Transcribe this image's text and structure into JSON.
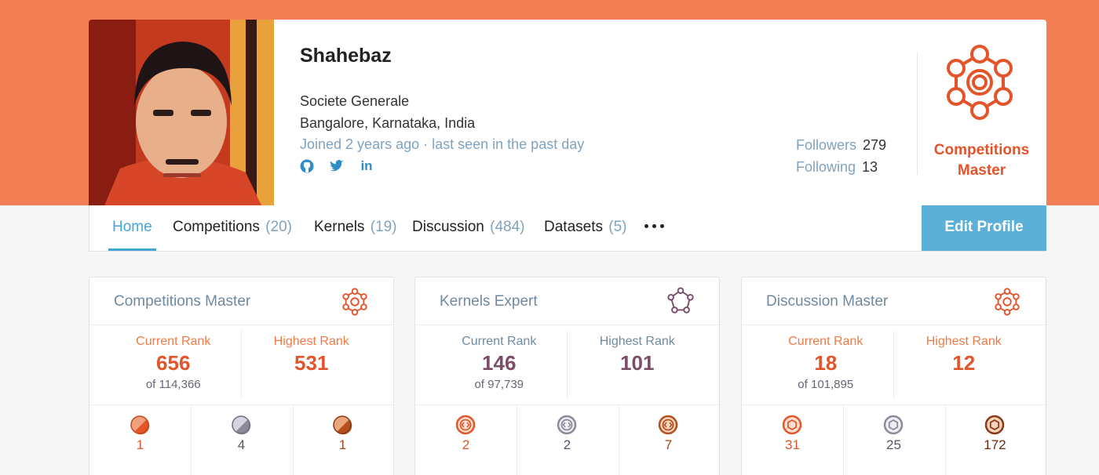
{
  "profile": {
    "name": "Shahebaz",
    "organization": "Societe Generale",
    "location": "Bangalore, Karnataka, India",
    "joined": "Joined 2 years ago · last seen in the past day",
    "socials": [
      {
        "icon": "github-icon"
      },
      {
        "icon": "twitter-icon"
      },
      {
        "icon": "linkedin-icon",
        "text": "in"
      }
    ],
    "followers_label": "Followers",
    "followers": "279",
    "following_label": "Following",
    "following": "13",
    "tier": "Competitions Master"
  },
  "colors": {
    "brand": "#f47f55",
    "master": "#e4542a",
    "expert": "#7b4d6a",
    "link": "#44a5d6",
    "muted": "#7fa3bf",
    "gold": "#e2562a",
    "silver": "#8a8a9a",
    "bronze": "#a5441c"
  },
  "nav": {
    "tabs": [
      {
        "label": "Home",
        "count": ""
      },
      {
        "label": "Competitions",
        "count": "(20)"
      },
      {
        "label": "Kernels",
        "count": "(19)"
      },
      {
        "label": "Discussion",
        "count": "(484)"
      },
      {
        "label": "Datasets",
        "count": "(5)"
      }
    ],
    "active": "Home",
    "more_icon": "more-dots-icon",
    "edit_button": "Edit Profile"
  },
  "cards": [
    {
      "title": "Competitions Master",
      "icon": "competitions-master-icon",
      "current_rank_label": "Current Rank",
      "current_rank": "656",
      "current_of": "of 114,366",
      "highest_rank_label": "Highest Rank",
      "highest_rank": "531",
      "medals": [
        {
          "type": "gold",
          "count": "1"
        },
        {
          "type": "silver",
          "count": "4"
        },
        {
          "type": "bronze",
          "count": "1"
        }
      ]
    },
    {
      "title": "Kernels Expert",
      "icon": "kernels-expert-icon",
      "current_rank_label": "Current Rank",
      "current_rank": "146",
      "current_of": "of 97,739",
      "highest_rank_label": "Highest Rank",
      "highest_rank": "101",
      "medals": [
        {
          "type": "gold",
          "count": "2"
        },
        {
          "type": "silver",
          "count": "2"
        },
        {
          "type": "bronze",
          "count": "7"
        }
      ]
    },
    {
      "title": "Discussion Master",
      "icon": "discussion-master-icon",
      "current_rank_label": "Current Rank",
      "current_rank": "18",
      "current_of": "of 101,895",
      "highest_rank_label": "Highest Rank",
      "highest_rank": "12",
      "medals": [
        {
          "type": "gold",
          "count": "31"
        },
        {
          "type": "silver",
          "count": "25"
        },
        {
          "type": "bronze",
          "count": "172"
        }
      ]
    }
  ]
}
